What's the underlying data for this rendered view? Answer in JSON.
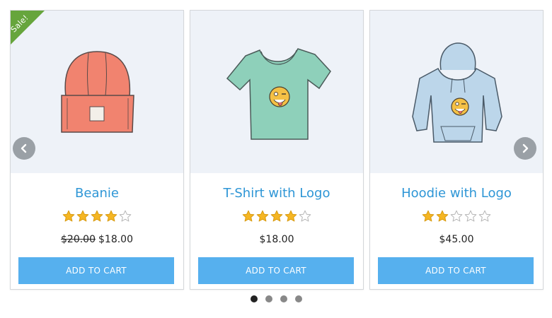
{
  "colors": {
    "title": "#2e96d6",
    "button": "#56b0ee",
    "sale_ribbon": "#66a53c",
    "star_filled": "#f5b623",
    "star_empty": "#cccccc"
  },
  "products": [
    {
      "title": "Beanie",
      "image": "beanie-image",
      "sale_badge": "Sale!",
      "rating": 4,
      "rating_max": 5,
      "price_old": "$20.00",
      "price": "$18.00",
      "button": "ADD TO CART"
    },
    {
      "title": "T-Shirt with Logo",
      "image": "tshirt-image",
      "rating": 4,
      "rating_max": 5,
      "price": "$18.00",
      "button": "ADD TO CART"
    },
    {
      "title": "Hoodie with Logo",
      "image": "hoodie-image",
      "rating": 2,
      "rating_max": 5,
      "price": "$45.00",
      "button": "ADD TO CART"
    }
  ],
  "navigation": {
    "prev_icon": "chevron-left-icon",
    "next_icon": "chevron-right-icon"
  },
  "pagination": {
    "pages": 4,
    "active": 1
  }
}
